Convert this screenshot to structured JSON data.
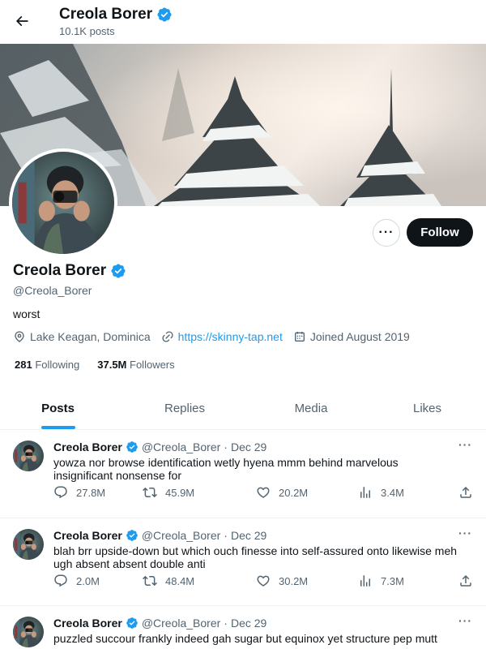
{
  "header": {
    "title": "Creola Borer",
    "post_count": "10.1K posts"
  },
  "profile": {
    "name": "Creola Borer",
    "handle": "@Creola_Borer",
    "bio": "worst",
    "location": "Lake Keagan, Dominica",
    "website": "https://skinny-tap.net",
    "joined": "Joined August 2019",
    "following_count": "281",
    "following_label": "Following",
    "followers_count": "37.5M",
    "followers_label": "Followers",
    "follow_label": "Follow",
    "more_label": "···"
  },
  "tabs": [
    {
      "label": "Posts",
      "active": true
    },
    {
      "label": "Replies",
      "active": false
    },
    {
      "label": "Media",
      "active": false
    },
    {
      "label": "Likes",
      "active": false
    }
  ],
  "posts": [
    {
      "name": "Creola Borer",
      "handle": "@Creola_Borer",
      "sep": "·",
      "date": "Dec 29",
      "text": "yowza nor browse identification wetly hyena mmm behind marvelous insignificant nonsense for",
      "replies": "27.8M",
      "reposts": "45.9M",
      "likes": "20.2M",
      "views": "3.4M"
    },
    {
      "name": "Creola Borer",
      "handle": "@Creola_Borer",
      "sep": "·",
      "date": "Dec 29",
      "text": "blah brr upside-down but which ouch finesse into self-assured onto likewise meh ugh absent absent double anti",
      "replies": "2.0M",
      "reposts": "48.4M",
      "likes": "30.2M",
      "views": "7.3M"
    },
    {
      "name": "Creola Borer",
      "handle": "@Creola_Borer",
      "sep": "·",
      "date": "Dec 29",
      "text": "puzzled succour frankly indeed gah sugar but equinox yet structure pep mutt",
      "replies": "",
      "reposts": "",
      "likes": "",
      "views": ""
    }
  ],
  "colors": {
    "accent": "#1d9bf0",
    "text": "#0f1419",
    "muted": "#536471",
    "verified": "#1d9bf0"
  }
}
